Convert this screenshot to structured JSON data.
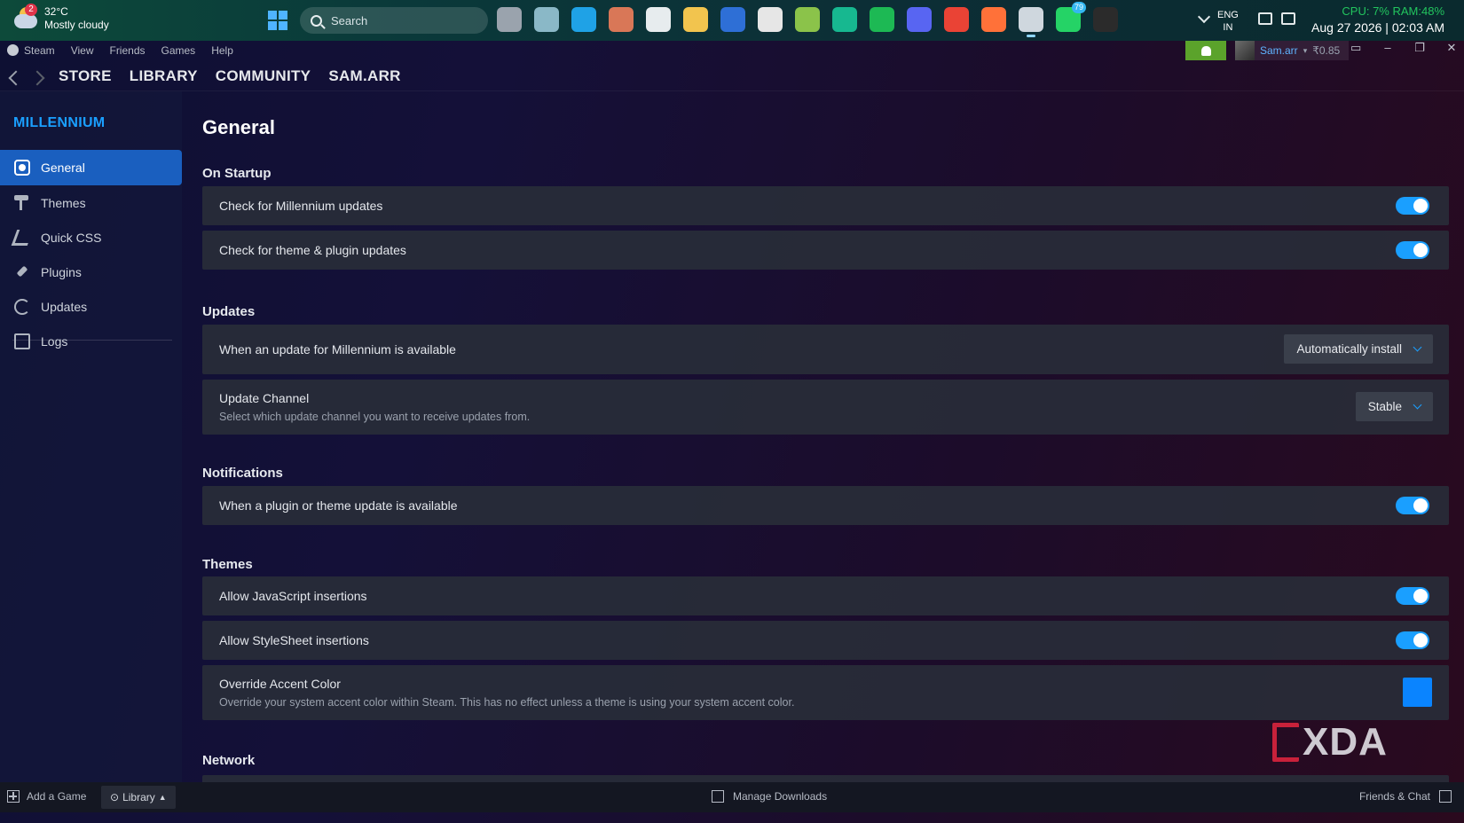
{
  "taskbar": {
    "weather": {
      "temp": "32°C",
      "condition": "Mostly cloudy",
      "badge": "2"
    },
    "search_placeholder": "Search",
    "apps": [
      {
        "name": "task-view-icon",
        "color": "#9aa3ad"
      },
      {
        "name": "copilot-icon",
        "color": "#8ab8c7"
      },
      {
        "name": "edge-icon",
        "color": "#1fa2e6"
      },
      {
        "name": "claude-icon",
        "color": "#d97757"
      },
      {
        "name": "chatgpt-icon",
        "color": "#e7ecee"
      },
      {
        "name": "file-explorer-icon",
        "color": "#f2c44e"
      },
      {
        "name": "stats-app-icon",
        "color": "#2e6fd6"
      },
      {
        "name": "microsoft-store-icon",
        "color": "#e6e6e6"
      },
      {
        "name": "notes-app-icon",
        "color": "#8bc34a"
      },
      {
        "name": "pixel-app-icon",
        "color": "#17b890"
      },
      {
        "name": "spotify-icon",
        "color": "#1db954"
      },
      {
        "name": "discord-icon",
        "color": "#5865f2"
      },
      {
        "name": "chrome-icon",
        "color": "#ea4335"
      },
      {
        "name": "firefox-icon",
        "color": "#ff7139"
      },
      {
        "name": "steam-icon",
        "color": "#cfd7de"
      },
      {
        "name": "whatsapp-icon",
        "color": "#25d366",
        "badge": "79"
      },
      {
        "name": "epic-games-icon",
        "color": "#2b2b2b"
      }
    ],
    "lang_line1": "ENG",
    "lang_line2": "IN",
    "perf": "CPU: 7% RAM:48%",
    "datetime": "Aug 27 2026 | 02:03 AM"
  },
  "menubar": {
    "items": [
      "Steam",
      "View",
      "Friends",
      "Games",
      "Help"
    ],
    "account_name": "Sam.arr",
    "balance": "₹0.85"
  },
  "nav": {
    "links": [
      "STORE",
      "LIBRARY",
      "COMMUNITY",
      "SAM.ARR"
    ]
  },
  "sidebar": {
    "brand": "MILLENNIUM",
    "items": [
      "General",
      "Themes",
      "Quick CSS",
      "Plugins",
      "Updates",
      "Logs"
    ]
  },
  "settings": {
    "page_title": "General",
    "sections": {
      "startup": "On Startup",
      "updates": "Updates",
      "notifications": "Notifications",
      "themes": "Themes",
      "network": "Network"
    },
    "check_millennium": {
      "label": "Check for Millennium updates",
      "on": true
    },
    "check_plugins": {
      "label": "Check for theme & plugin updates",
      "on": true
    },
    "update_available": {
      "label": "When an update for Millennium is available",
      "value": "Automatically install"
    },
    "update_channel": {
      "label": "Update Channel",
      "desc": "Select which update channel you want to receive updates from.",
      "value": "Stable"
    },
    "notify_plugin": {
      "label": "When a plugin or theme update is available",
      "on": true
    },
    "allow_js": {
      "label": "Allow JavaScript insertions",
      "on": true
    },
    "allow_css": {
      "label": "Allow StyleSheet insertions",
      "on": true
    },
    "accent": {
      "label": "Override Accent Color",
      "desc": "Override your system accent color within Steam. This has no effect unless a theme is using your system accent color.",
      "color": "#0a84ff"
    }
  },
  "watermark": "XDA",
  "footer": {
    "add_game": "Add a Game",
    "library": "Library",
    "downloads": "Manage Downloads",
    "friends": "Friends & Chat"
  }
}
